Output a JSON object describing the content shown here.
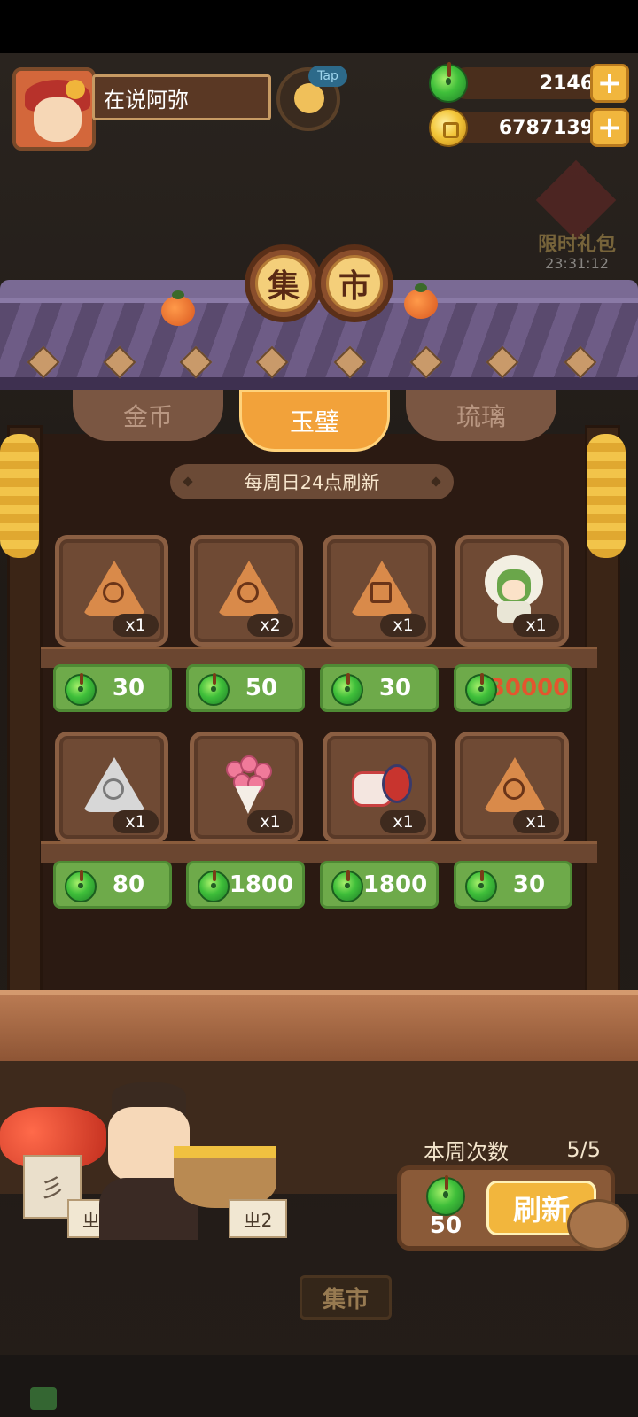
{
  "player": {
    "name": "在说阿弥",
    "tap_label": "Tap"
  },
  "currencies": {
    "jade": {
      "amount": "2146",
      "icon": "jade-icon",
      "plus_label": "+"
    },
    "coin": {
      "amount": "6787139",
      "icon": "coin-icon",
      "plus_label": "+"
    }
  },
  "gift_sign": {
    "title": "限时礼包",
    "timer": "23:31:12"
  },
  "market": {
    "title_chars": [
      "集",
      "市"
    ],
    "tabs": [
      {
        "label": "金币",
        "active": false
      },
      {
        "label": "玉璧",
        "active": true
      },
      {
        "label": "琉璃",
        "active": false
      }
    ],
    "refresh_note": "每周日24点刷新",
    "items": [
      {
        "art": "orange-mooncake-flower",
        "qty": "x1",
        "price": "30"
      },
      {
        "art": "orange-mooncake-cross",
        "qty": "x2",
        "price": "50"
      },
      {
        "art": "orange-mooncake-glyph",
        "qty": "x1",
        "price": "30"
      },
      {
        "art": "green-hair-doll",
        "qty": "x1",
        "price": "30000"
      },
      {
        "art": "white-mooncake-swirl",
        "qty": "x1",
        "price": "80"
      },
      {
        "art": "pink-bouquet",
        "qty": "x1",
        "price": "1800"
      },
      {
        "art": "porcelain-jar",
        "qty": "x1",
        "price": "1800"
      },
      {
        "art": "orange-mooncake-rose",
        "qty": "x1",
        "price": "30"
      }
    ],
    "price_highlight": "30000"
  },
  "refresh_panel": {
    "weekly_label": "本周次数",
    "weekly_count": "5/5",
    "cost": "50",
    "button_label": "刷新"
  },
  "background": {
    "bottom_sign": "集市",
    "tag_tall": "彡",
    "tag_left": "ㄓ2",
    "tag_right": "ㄓ2"
  },
  "colors": {
    "price_green": "#6eaa4a",
    "tab_active": "#f2a23a",
    "refresh_button": "#f2b63d",
    "highlight_price_text": "#e4552e"
  }
}
